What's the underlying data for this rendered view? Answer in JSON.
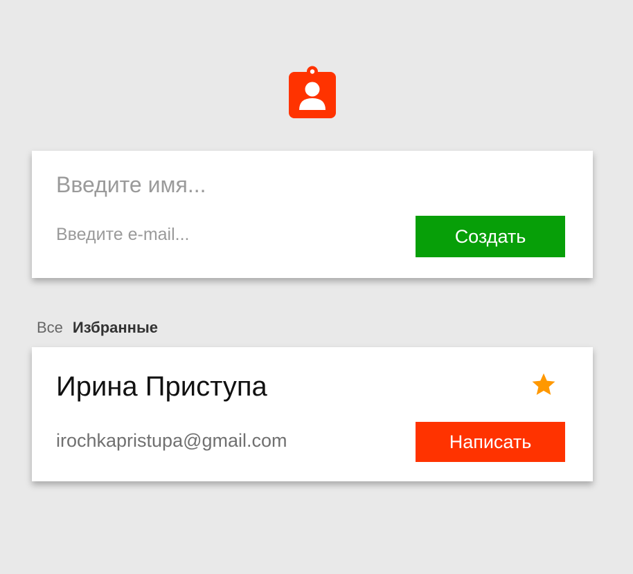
{
  "app": {
    "logo_icon": "contact-badge-icon",
    "accent_color": "#ff3300"
  },
  "form": {
    "name_placeholder": "Введите имя...",
    "email_placeholder": "Введите e-mail...",
    "create_label": "Создать",
    "create_color": "#079f08"
  },
  "filters": {
    "tabs": [
      {
        "label": "Все",
        "active": false
      },
      {
        "label": "Избранные",
        "active": true
      }
    ]
  },
  "contacts": [
    {
      "name": "Ирина Приступа",
      "email": "irochkapristupa@gmail.com",
      "favorite": true,
      "favorite_icon": "star-icon",
      "favorite_color": "#ff9800",
      "action_label": "Написать",
      "action_color": "#ff3300"
    }
  ]
}
